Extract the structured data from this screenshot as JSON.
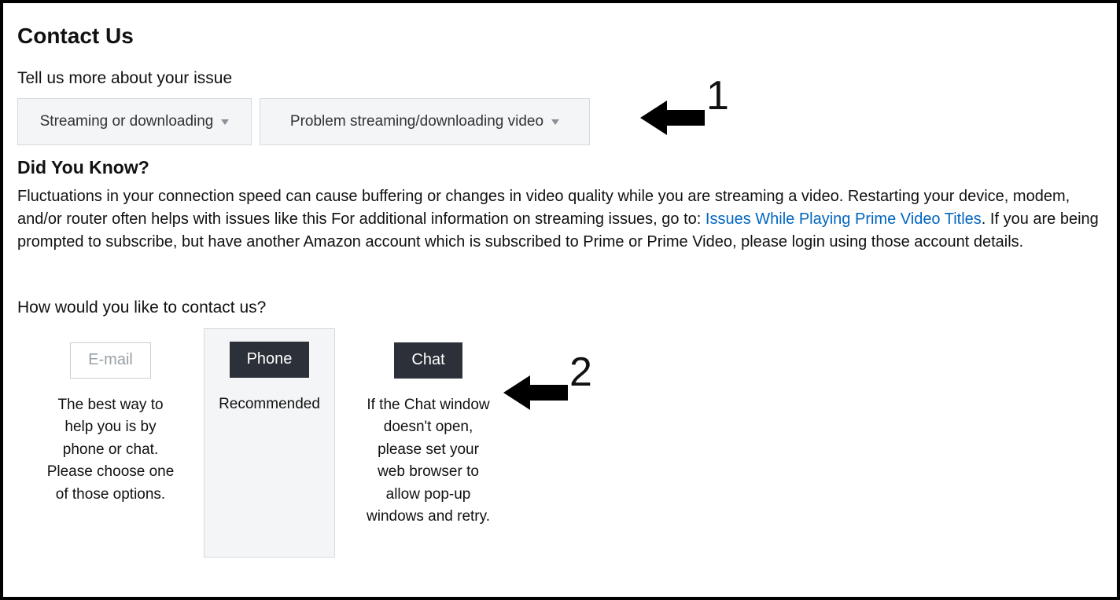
{
  "title": "Contact Us",
  "prompt": "Tell us more about your issue",
  "dropdown1": {
    "label": "Streaming or downloading"
  },
  "dropdown2": {
    "label": "Problem streaming/downloading video"
  },
  "dyk": {
    "heading": "Did You Know?",
    "text_before_link": "Fluctuations in your connection speed can cause buffering or changes in video quality while you are streaming a video. Restarting your device, modem, and/or router often helps with issues like this For additional information on streaming issues, go to: ",
    "link_text": "Issues While Playing Prime Video Titles",
    "text_after_link": ". If you are being prompted to subscribe, but have another Amazon account which is subscribed to Prime or Prime Video, please login using those account details."
  },
  "how": "How would you like to contact us?",
  "options": {
    "email": {
      "label": "E-mail",
      "note": "The best way to help you is by phone or chat. Please choose one of those options."
    },
    "phone": {
      "label": "Phone",
      "note": "Recommended"
    },
    "chat": {
      "label": "Chat",
      "note": "If the Chat window doesn't open, please set your web browser to allow pop-up windows and retry."
    }
  },
  "annotations": {
    "a1": "1",
    "a2": "2"
  }
}
